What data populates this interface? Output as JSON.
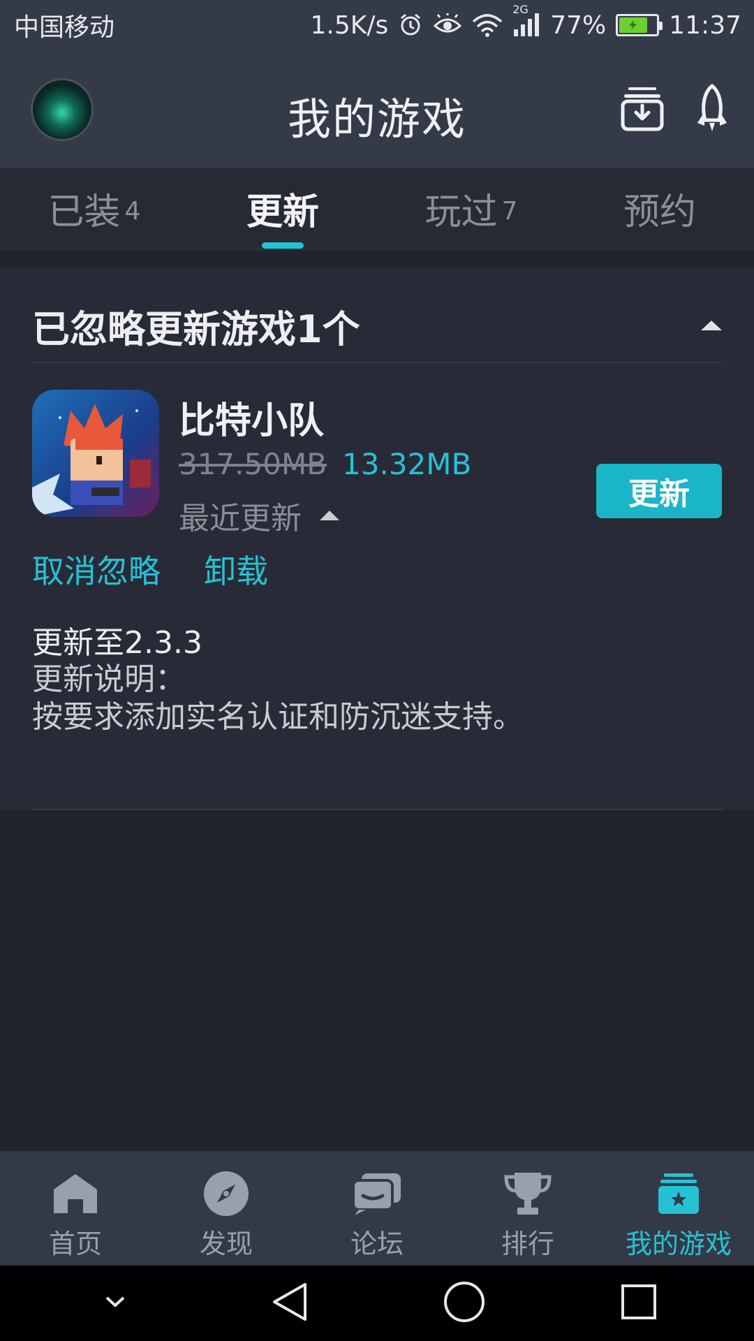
{
  "status_bar": {
    "carrier": "中国移动",
    "net_speed": "1.5K/s",
    "signal_type": "2G",
    "battery": "77%",
    "battery_level": 0.77,
    "time": "11:37"
  },
  "header": {
    "title": "我的游戏",
    "download_icon": "download-box-icon",
    "rocket_icon": "rocket-icon"
  },
  "tabs": [
    {
      "label": "已装",
      "count": "4"
    },
    {
      "label": "更新",
      "count": ""
    },
    {
      "label": "玩过",
      "count": "7"
    },
    {
      "label": "预约",
      "count": ""
    }
  ],
  "active_tab": 1,
  "ignored_section": {
    "title": "已忽略更新游戏1个",
    "game": {
      "name": "比特小队",
      "old_size": "317.50MB",
      "new_size": "13.32MB",
      "recent_label": "最近更新",
      "update_button": "更新",
      "cancel_ignore": "取消忽略",
      "uninstall": "卸载",
      "update_to": "更新至2.3.3",
      "notes_label": "更新说明：",
      "notes": "按要求添加实名认证和防沉迷支持。"
    }
  },
  "bottom_nav": [
    {
      "label": "首页",
      "icon": "home-icon"
    },
    {
      "label": "发现",
      "icon": "compass-icon"
    },
    {
      "label": "论坛",
      "icon": "chat-icon"
    },
    {
      "label": "排行",
      "icon": "trophy-icon"
    },
    {
      "label": "我的游戏",
      "icon": "my-games-icon"
    }
  ],
  "colors": {
    "accent": "#25c2d4",
    "background": "#21232d",
    "header": "#353a48"
  }
}
